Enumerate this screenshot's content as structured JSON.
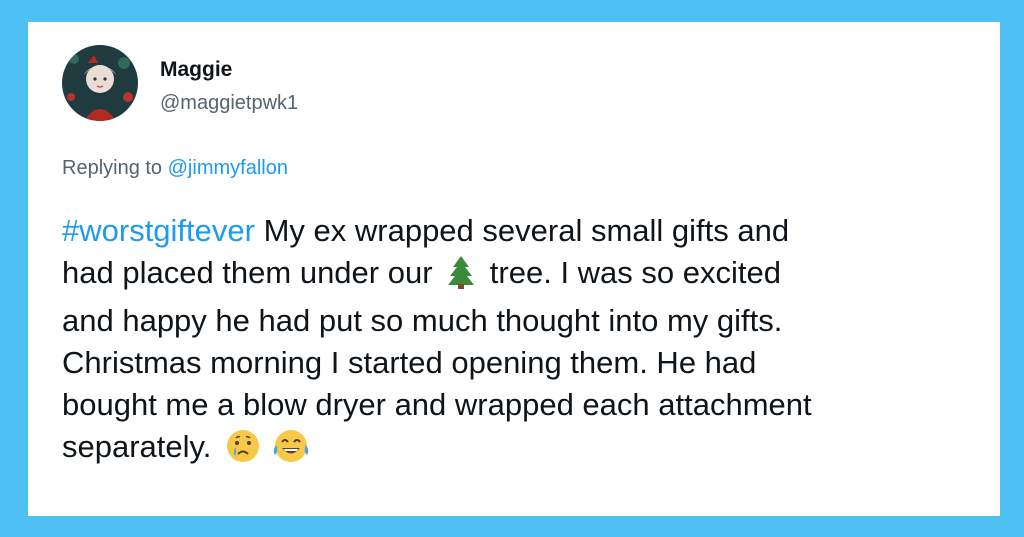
{
  "user": {
    "name": "Maggie",
    "handle": "@maggietpwk1"
  },
  "reply": {
    "prefix": "Replying to",
    "mention": "@jimmyfallon"
  },
  "tweet": {
    "hashtag": "#worstgiftever",
    "line1": " My ex wrapped several small gifts and",
    "line2a": "had placed them under our",
    "line2b": "tree. I was so excited",
    "line3": "and happy he had put so much thought into my gifts.",
    "line4": "Christmas morning I started opening them. He had",
    "line5": "bought me a blow dryer and wrapped each attachment",
    "line6": "separately.",
    "icons": [
      "christmas-tree-icon",
      "crying-face-icon",
      "tears-of-joy-icon"
    ]
  },
  "colors": {
    "frame": "#4fc0f4",
    "link": "#1d9bf0",
    "text": "#0f1419",
    "muted": "#536471"
  }
}
